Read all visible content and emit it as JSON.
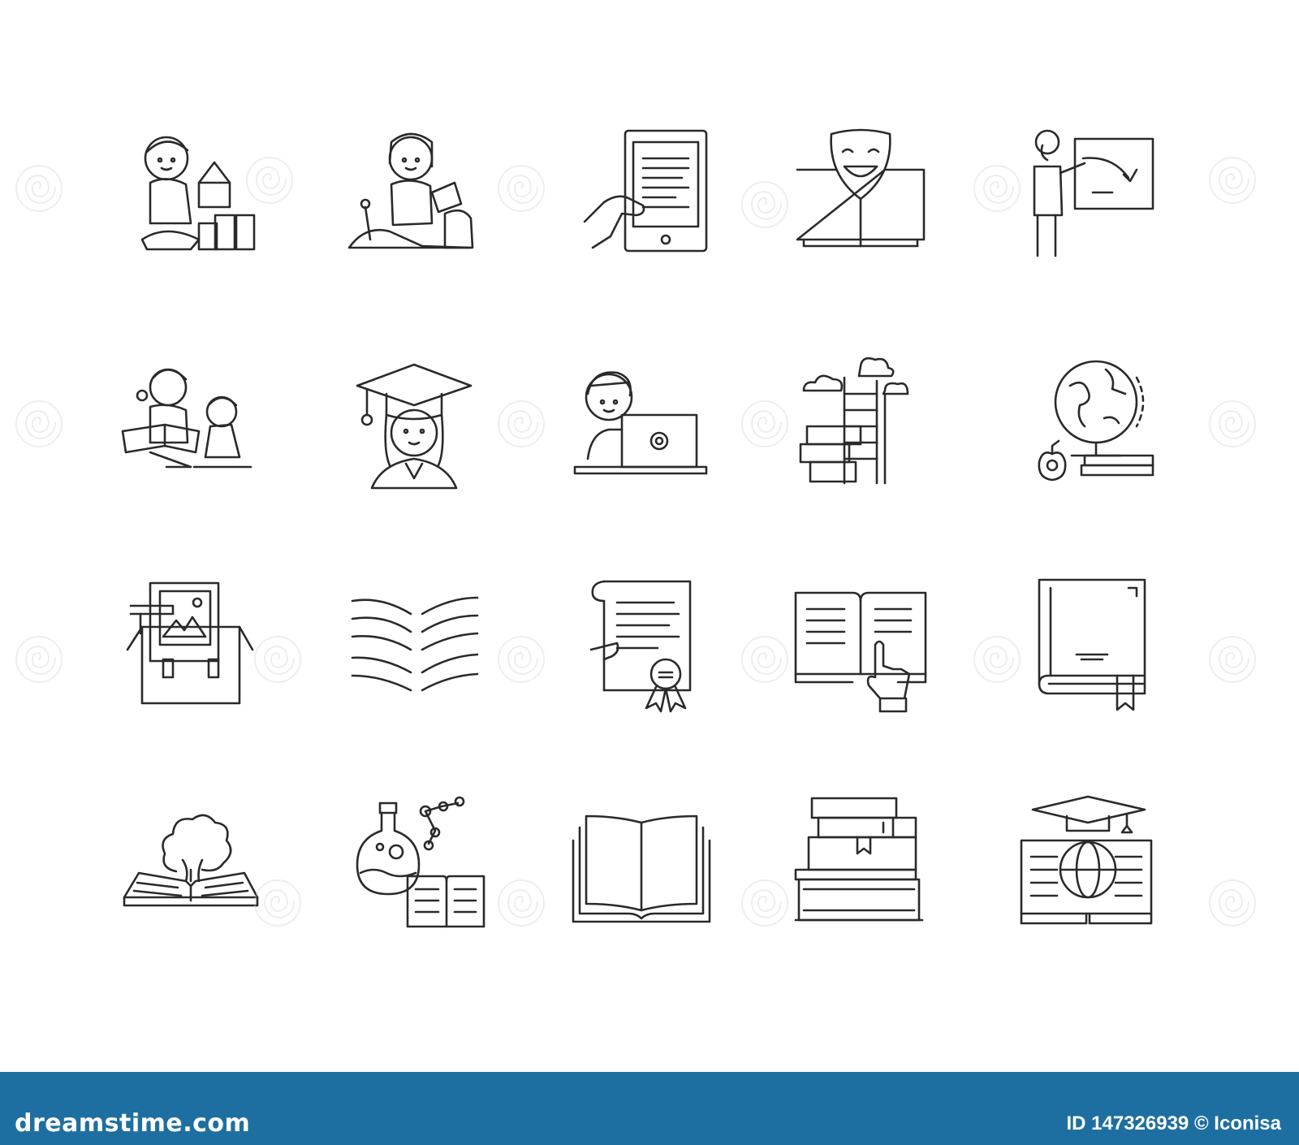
{
  "theme": {
    "background": "#ffffff",
    "line_color": "#2a2a2a",
    "footer_color": "#1e6fa1",
    "watermark_color": "#cfcfcf"
  },
  "icons": [
    "child-building-blocks-icon",
    "child-sandbox-icon",
    "tablet-reader-icon",
    "comedy-book-icon",
    "teacher-blackboard-icon",
    "mother-reading-to-child-icon",
    "graduate-girl-icon",
    "student-laptop-icon",
    "book-stairs-clouds-icon",
    "globe-apple-books-icon",
    "school-bag-picture-icon",
    "open-book-pages-icon",
    "diploma-certificate-icon",
    "book-pointing-hand-icon",
    "closed-book-bookmark-icon",
    "book-tree-icon",
    "chemistry-flask-book-icon",
    "open-book-icon",
    "books-stack-icon",
    "globe-graduation-cap-book-icon"
  ],
  "footer": {
    "logo": "dreamstime.com",
    "credit": "ID 147326939 © Iconisa"
  }
}
